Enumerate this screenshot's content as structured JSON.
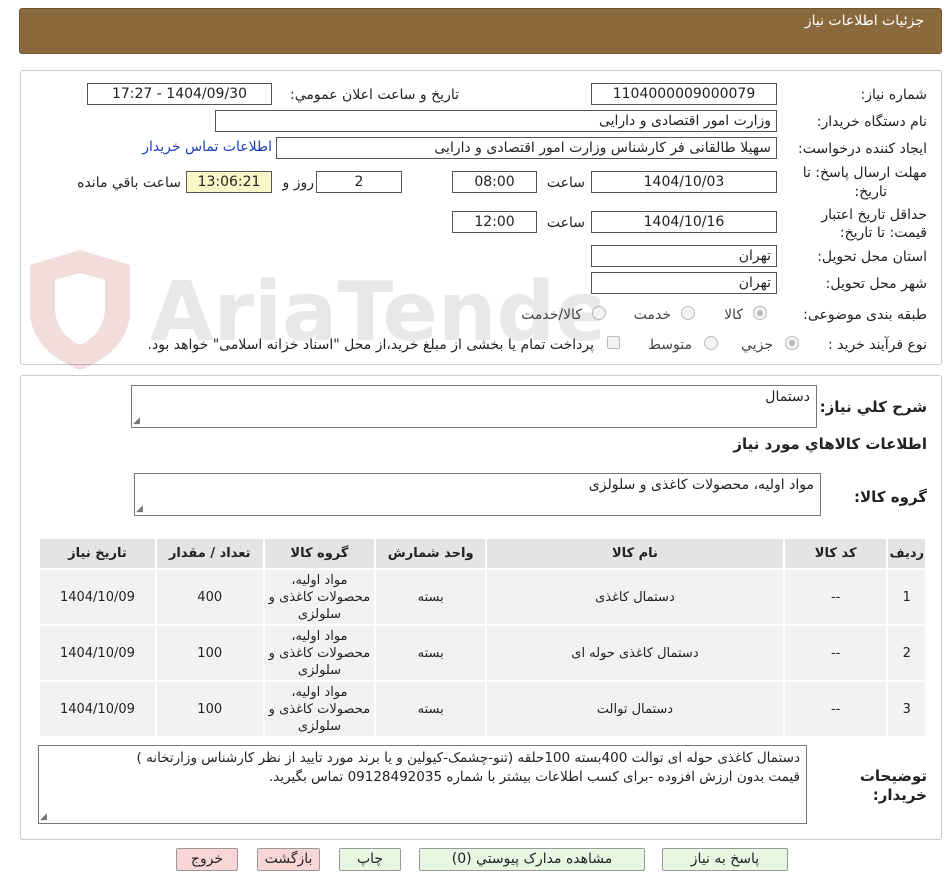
{
  "header": {
    "title": "جزئیات اطلاعات نیاز"
  },
  "form": {
    "need_number_label": "شماره نیاز:",
    "need_number": "1104000009000079",
    "announce_label": "تاریخ و ساعت اعلان عمومي:",
    "announce_value": "1404/09/30 - 17:27",
    "buyer_org_label": "نام دستگاه خريدار:",
    "buyer_org": "وزارت امور اقتصادی و دارایی",
    "creator_label": "ایجاد کننده درخواست:",
    "creator": "سهیلا طالقانی فر کارشناس وزارت امور اقتصادی و دارایی",
    "contact_link": "اطلاعات تماس خريدار",
    "deadline_label_1": "مهلت ارسال پاسخ: تا",
    "deadline_label_2": "تاريخ:",
    "deadline_date": "1404/10/03",
    "time_label": "ساعت",
    "deadline_time": "08:00",
    "days_value": "2",
    "days_label": "روز و",
    "remaining_time": "13:06:21",
    "remaining_label": "ساعت باقي مانده",
    "validity_label_1": "حداقل تاريخ اعتبار",
    "validity_label_2": "قيمت: تا تاريخ:",
    "validity_date": "1404/10/16",
    "validity_time": "12:00",
    "province_label": "استان محل تحویل:",
    "province": "تهران",
    "city_label": "شهر محل تحویل:",
    "city": "تهران",
    "category_label": "طبقه بندی موضوعی:",
    "category_options": [
      "کالا",
      "خدمت",
      "کالا/خدمت"
    ],
    "process_label": "نوع فرآیند خرید :",
    "process_options": [
      "جزیي",
      "متوسط"
    ],
    "payment_note": "پرداخت تمام يا بخشی از مبلغ خريد،از محل \"اسناد خزانه اسلامی\" خواهد بود."
  },
  "watermark": {
    "text": "AriaTender.neT"
  },
  "summary": {
    "label": "شرح کلي نياز:",
    "value": "دستمال",
    "items_title": "اطلاعات کالاهاي مورد نياز",
    "group_label": "گروه کالا:",
    "group_value": "مواد اولیه، محصولات کاغذی و سلولزی"
  },
  "table": {
    "headers": [
      "رديف",
      "کد کالا",
      "نام کالا",
      "واحد شمارش",
      "گروه کالا",
      "تعداد / مقدار",
      "تاريخ نياز"
    ],
    "rows": [
      {
        "index": "1",
        "code": "--",
        "name": "دستمال کاغذی",
        "unit": "بسته",
        "group": "مواد اولیه، محصولات کاغذی و سلولزی",
        "qty": "400",
        "date": "1404/10/09"
      },
      {
        "index": "2",
        "code": "--",
        "name": "دستمال کاغذی حوله ای",
        "unit": "بسته",
        "group": "مواد اولیه، محصولات کاغذی و سلولزی",
        "qty": "100",
        "date": "1404/10/09"
      },
      {
        "index": "3",
        "code": "--",
        "name": "دستمال توالت",
        "unit": "بسته",
        "group": "مواد اولیه، محصولات کاغذی و سلولزی",
        "qty": "100",
        "date": "1404/10/09"
      }
    ]
  },
  "notes": {
    "label_1": "توضيحات",
    "label_2": "خريدار:",
    "line1": "دستمال کاغذی حوله ای توالت 400بسته 100حلقه (تنو-چشمک-کیولین و یا برند مورد تایید از نظر کارشناس وزارتخانه )",
    "line2": "قیمت بدون ارزش افزوده -برای کسب اطلاعات بیشتر با شماره 09128492035 تماس بگیرید."
  },
  "buttons": {
    "reply": "پاسخ به نياز",
    "attachments": "مشاهده مدارک پيوستي (0)",
    "print": "چاپ",
    "back": "بازگشت",
    "exit": "خروج"
  }
}
